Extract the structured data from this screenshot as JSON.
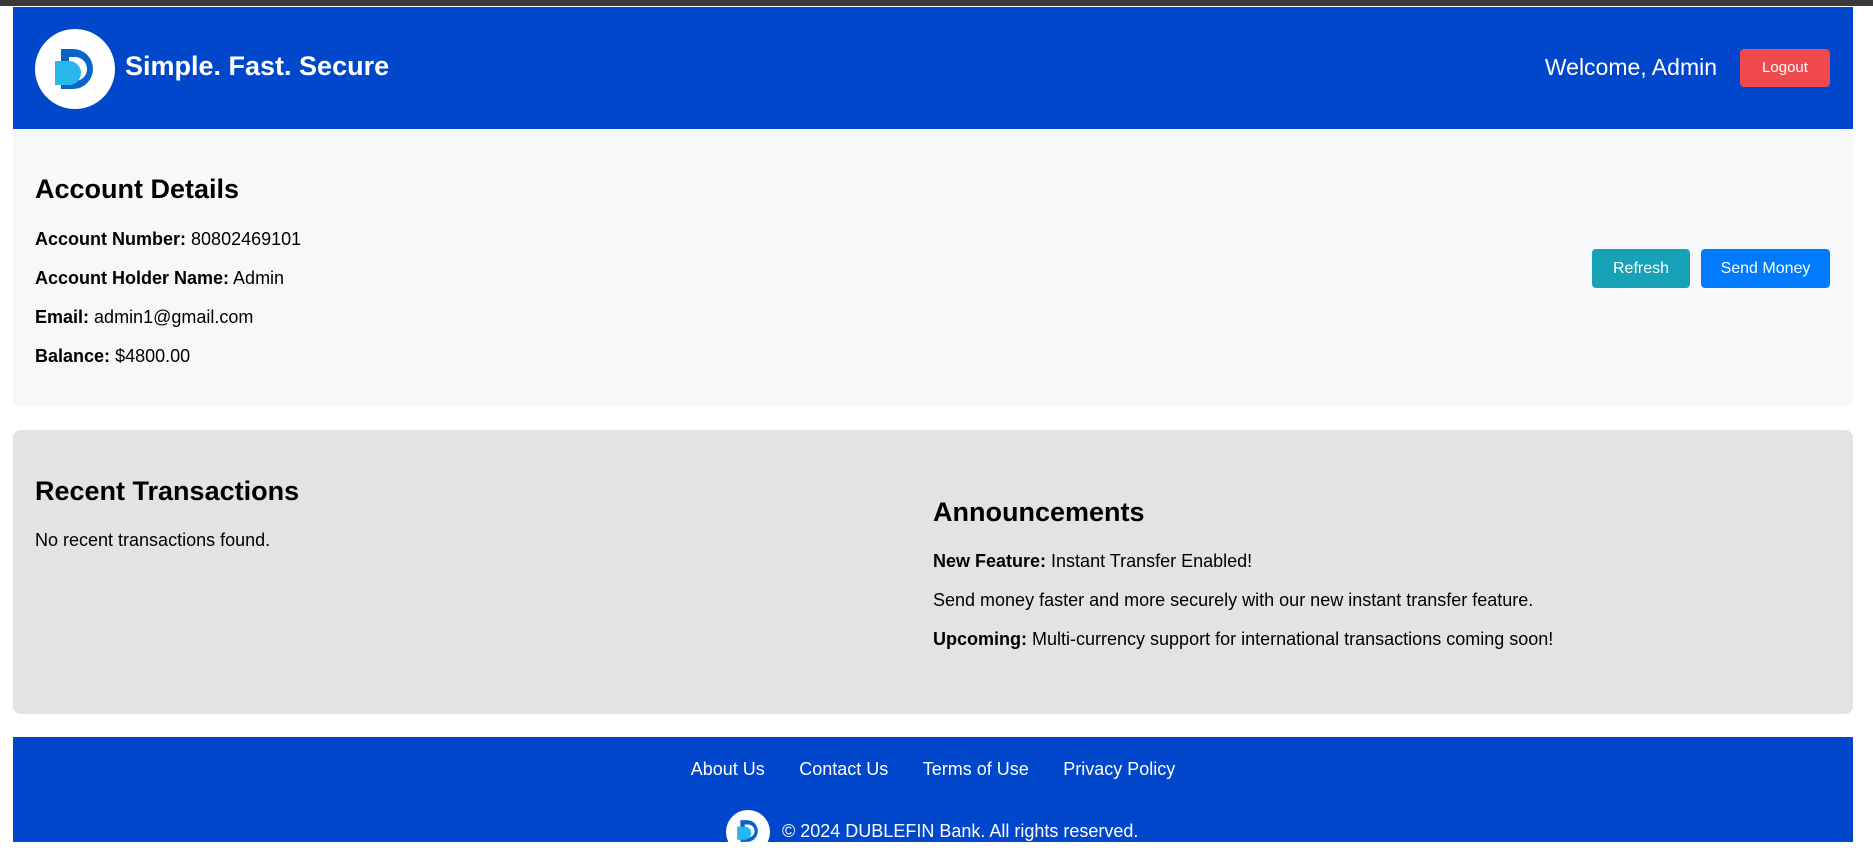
{
  "header": {
    "brand": "Simple. Fast. Secure",
    "welcome": "Welcome, Admin",
    "logout_label": "Logout"
  },
  "account": {
    "title": "Account Details",
    "number_label": "Account Number:",
    "number_value": "80802469101",
    "holder_label": "Account Holder Name:",
    "holder_value": "Admin",
    "email_label": "Email:",
    "email_value": "admin1@gmail.com",
    "balance_label": "Balance:",
    "balance_value": "$4800.00",
    "refresh_label": "Refresh",
    "send_label": "Send Money"
  },
  "transactions": {
    "title": "Recent Transactions",
    "empty_text": "No recent transactions found."
  },
  "announcements": {
    "title": "Announcements",
    "item1_label": "New Feature:",
    "item1_text": "Instant Transfer Enabled!",
    "item2_text": "Send money faster and more securely with our new instant transfer feature.",
    "item3_label": "Upcoming:",
    "item3_text": "Multi-currency support for international transactions coming soon!"
  },
  "footer": {
    "links": [
      "About Us",
      "Contact Us",
      "Terms of Use",
      "Privacy Policy"
    ],
    "copyright": "© 2024 DUBLEFIN Bank. All rights reserved."
  },
  "colors": {
    "brand_blue": "#0047cc",
    "logout_red": "#f04a4e",
    "refresh_teal": "#17a2b8",
    "send_blue": "#007bff"
  }
}
